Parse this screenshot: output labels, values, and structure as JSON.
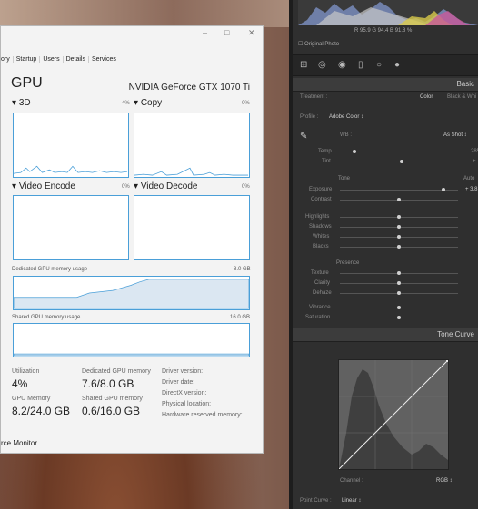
{
  "taskmanager": {
    "tabs": [
      "ory",
      "Startup",
      "Users",
      "Details",
      "Services"
    ],
    "title": "GPU",
    "gpu_name": "NVIDIA GeForce GTX 1070 Ti",
    "engines": [
      {
        "name": "3D",
        "pct": "4%"
      },
      {
        "name": "Copy",
        "pct": "0%"
      },
      {
        "name": "Video Encode",
        "pct": "0%"
      },
      {
        "name": "Video Decode",
        "pct": "0%"
      }
    ],
    "dedicated_label": "Dedicated GPU memory usage",
    "dedicated_max": "8.0 GB",
    "shared_label": "Shared GPU memory usage",
    "shared_max": "16.0 GB",
    "stats": {
      "utilization_label": "Utilization",
      "utilization": "4%",
      "dedicated_mem_label": "Dedicated GPU memory",
      "dedicated_mem": "7.6/8.0 GB",
      "gpu_memory_label": "GPU Memory",
      "gpu_memory": "8.2/24.0 GB",
      "shared_mem_label": "Shared GPU memory",
      "shared_mem": "0.6/16.0 GB"
    },
    "driver": [
      "Driver version:",
      "Driver date:",
      "DirectX version:",
      "Physical location:",
      "Hardware reserved memory:"
    ],
    "footer": "rce Monitor",
    "win_min": "–",
    "win_max": "□",
    "win_close": "✕"
  },
  "lightroom": {
    "rgb_readout": "R 95.9  G 94.4  B 91.8 %",
    "original_photo": "Original Photo",
    "basic_label": "Basic",
    "treatment_label": "Treatment :",
    "treatment_color": "Color",
    "treatment_bw": "Black & Whi",
    "profile_label": "Profile :",
    "profile_value": "Adobe Color ↕",
    "wb_label": "WB :",
    "wb_value": "As Shot ↕",
    "temp_label": "Temp",
    "temp_value": "285",
    "tint_label": "Tint",
    "tint_value": "+",
    "tone_label": "Tone",
    "auto_label": "Auto",
    "exposure_label": "Exposure",
    "exposure_value": "+ 3.8",
    "contrast_label": "Contrast",
    "highlights_label": "Highlights",
    "shadows_label": "Shadows",
    "whites_label": "Whites",
    "blacks_label": "Blacks",
    "presence_label": "Presence",
    "texture_label": "Texture",
    "clarity_label": "Clarity",
    "dehaze_label": "Dehaze",
    "vibrance_label": "Vibrance",
    "saturation_label": "Saturation",
    "tone_curve_label": "Tone Curve",
    "channel_label": "Channel :",
    "channel_value": "RGB ↕",
    "point_curve_label": "Point Curve :",
    "point_curve_value": "Linear ↕",
    "accent": "#cfcfcf"
  }
}
